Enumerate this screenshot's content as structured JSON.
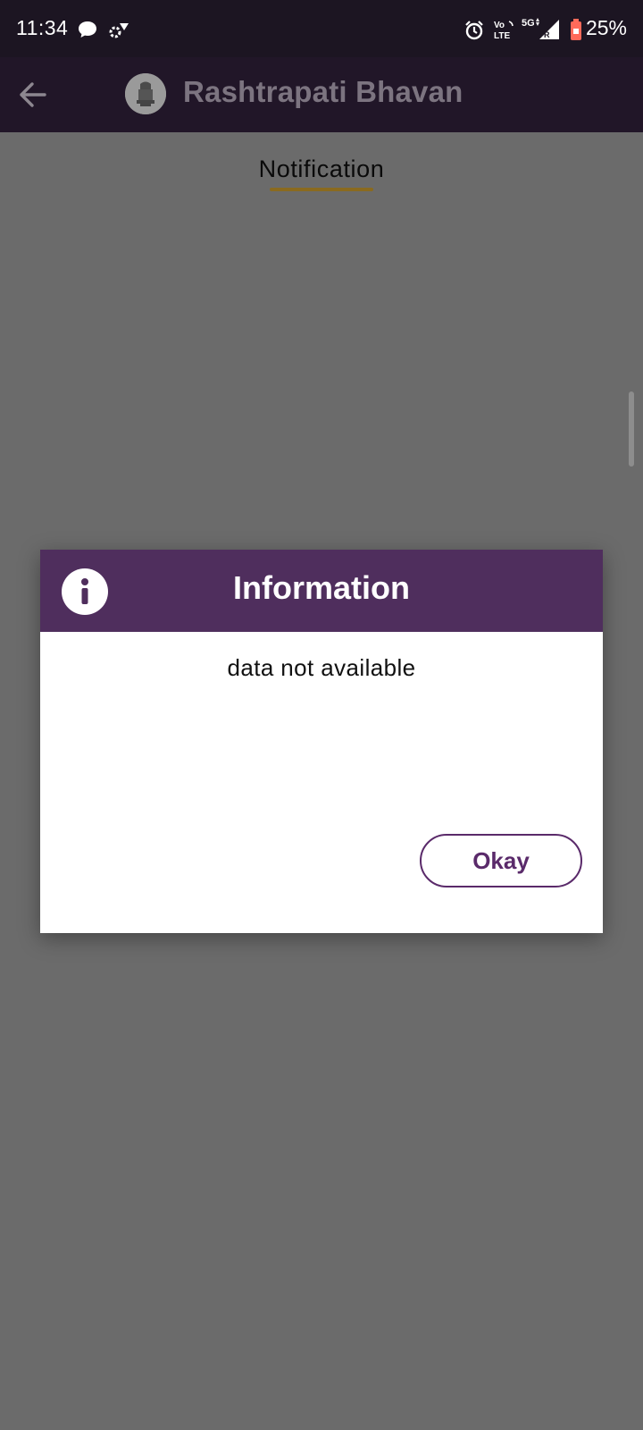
{
  "status_bar": {
    "time": "11:34",
    "battery": "25%",
    "network_label": "5G",
    "volte_label": "Vo\nLTE"
  },
  "app_bar": {
    "title": "Rashtrapati Bhavan"
  },
  "page": {
    "heading": "Notification"
  },
  "dialog": {
    "title": "Information",
    "message": "data not available",
    "okay_label": "Okay"
  },
  "colors": {
    "app_bar_bg": "#211628",
    "dialog_header_bg": "#4f2e5d",
    "okay_accent": "#5a2a6a",
    "heading_underline": "#8a6a1f",
    "scrim": "#6b6b6b"
  },
  "icons": [
    "chat-bubble-icon",
    "hotspot-icon",
    "alarm-icon",
    "volte-icon",
    "signal-icon",
    "battery-icon",
    "back-arrow-icon",
    "emblem-icon",
    "info-icon"
  ]
}
